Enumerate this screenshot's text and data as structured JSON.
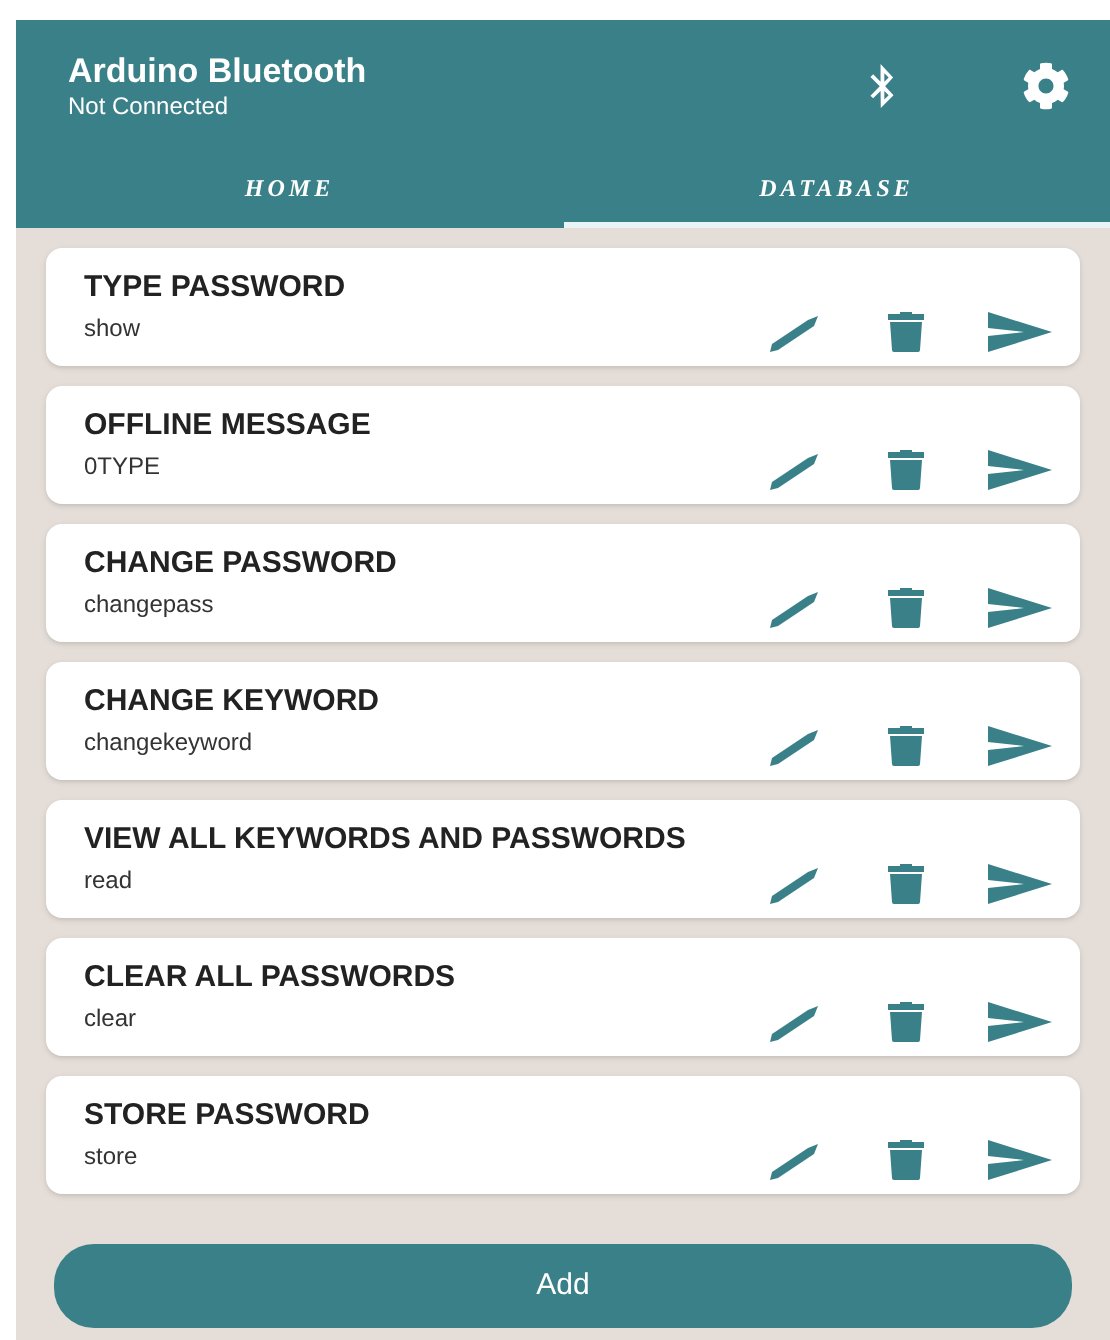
{
  "app_bar": {
    "title": "Arduino Bluetooth",
    "subtitle": "Not Connected"
  },
  "tabs": [
    {
      "label": "HOME",
      "selected": false
    },
    {
      "label": "DATABASE",
      "selected": true
    }
  ],
  "commands": [
    {
      "name": "TYPE PASSWORD",
      "command": "show"
    },
    {
      "name": "OFFLINE MESSAGE",
      "command": "0TYPE"
    },
    {
      "name": "CHANGE PASSWORD",
      "command": "changepass"
    },
    {
      "name": "CHANGE KEYWORD",
      "command": "changekeyword"
    },
    {
      "name": "VIEW ALL KEYWORDS AND PASSWORDS",
      "command": "read"
    },
    {
      "name": "CLEAR ALL PASSWORDS",
      "command": "clear"
    },
    {
      "name": "STORE PASSWORD",
      "command": "store"
    }
  ],
  "add_button": {
    "label": "Add"
  }
}
